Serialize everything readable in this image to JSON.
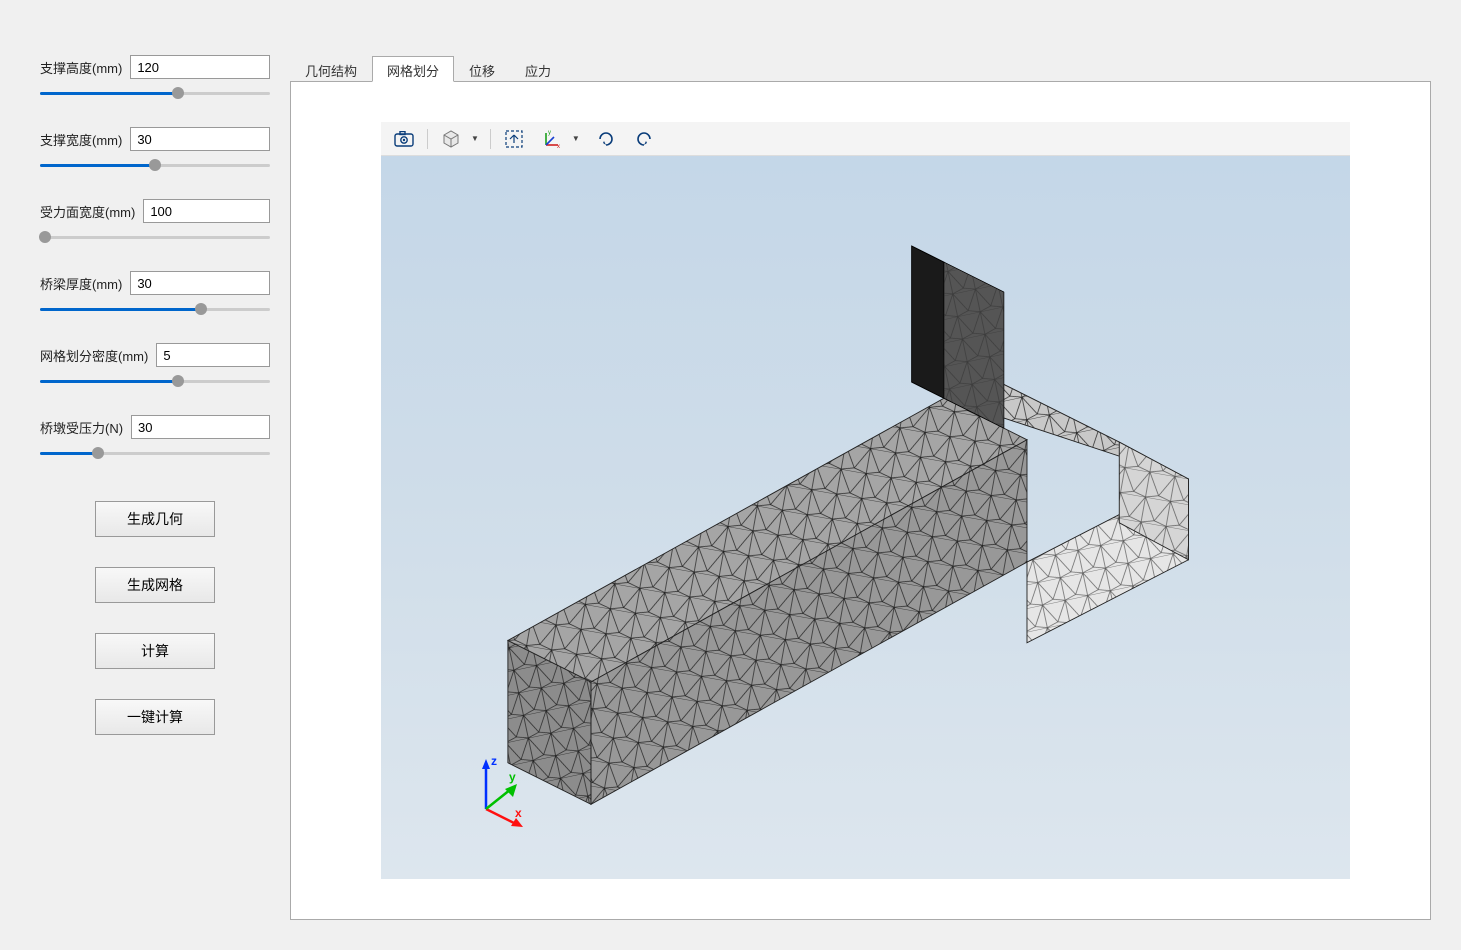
{
  "params": [
    {
      "label": "支撑高度(mm)",
      "value": "120",
      "fill_pct": 60,
      "thumb_pct": 60
    },
    {
      "label": "支撑宽度(mm)",
      "value": "30",
      "fill_pct": 50,
      "thumb_pct": 50
    },
    {
      "label": "受力面宽度(mm)",
      "value": "100",
      "fill_pct": 2,
      "thumb_pct": 2
    },
    {
      "label": "桥梁厚度(mm)",
      "value": "30",
      "fill_pct": 70,
      "thumb_pct": 70
    },
    {
      "label": "网格划分密度(mm)",
      "value": "5",
      "fill_pct": 60,
      "thumb_pct": 60
    },
    {
      "label": "桥墩受压力(N)",
      "value": "30",
      "fill_pct": 25,
      "thumb_pct": 25
    }
  ],
  "buttons": {
    "generate_geometry": "生成几何",
    "generate_mesh": "生成网格",
    "calculate": "计算",
    "one_click_calculate": "一键计算"
  },
  "tabs": [
    {
      "label": "几何结构",
      "active": false
    },
    {
      "label": "网格划分",
      "active": true
    },
    {
      "label": "位移",
      "active": false
    },
    {
      "label": "应力",
      "active": false
    }
  ],
  "toolbar": {
    "icons": [
      "camera",
      "cube",
      "fit",
      "axes",
      "rotate-right",
      "rotate-left"
    ]
  },
  "axes": {
    "x": "x",
    "y": "y",
    "z": "z"
  }
}
